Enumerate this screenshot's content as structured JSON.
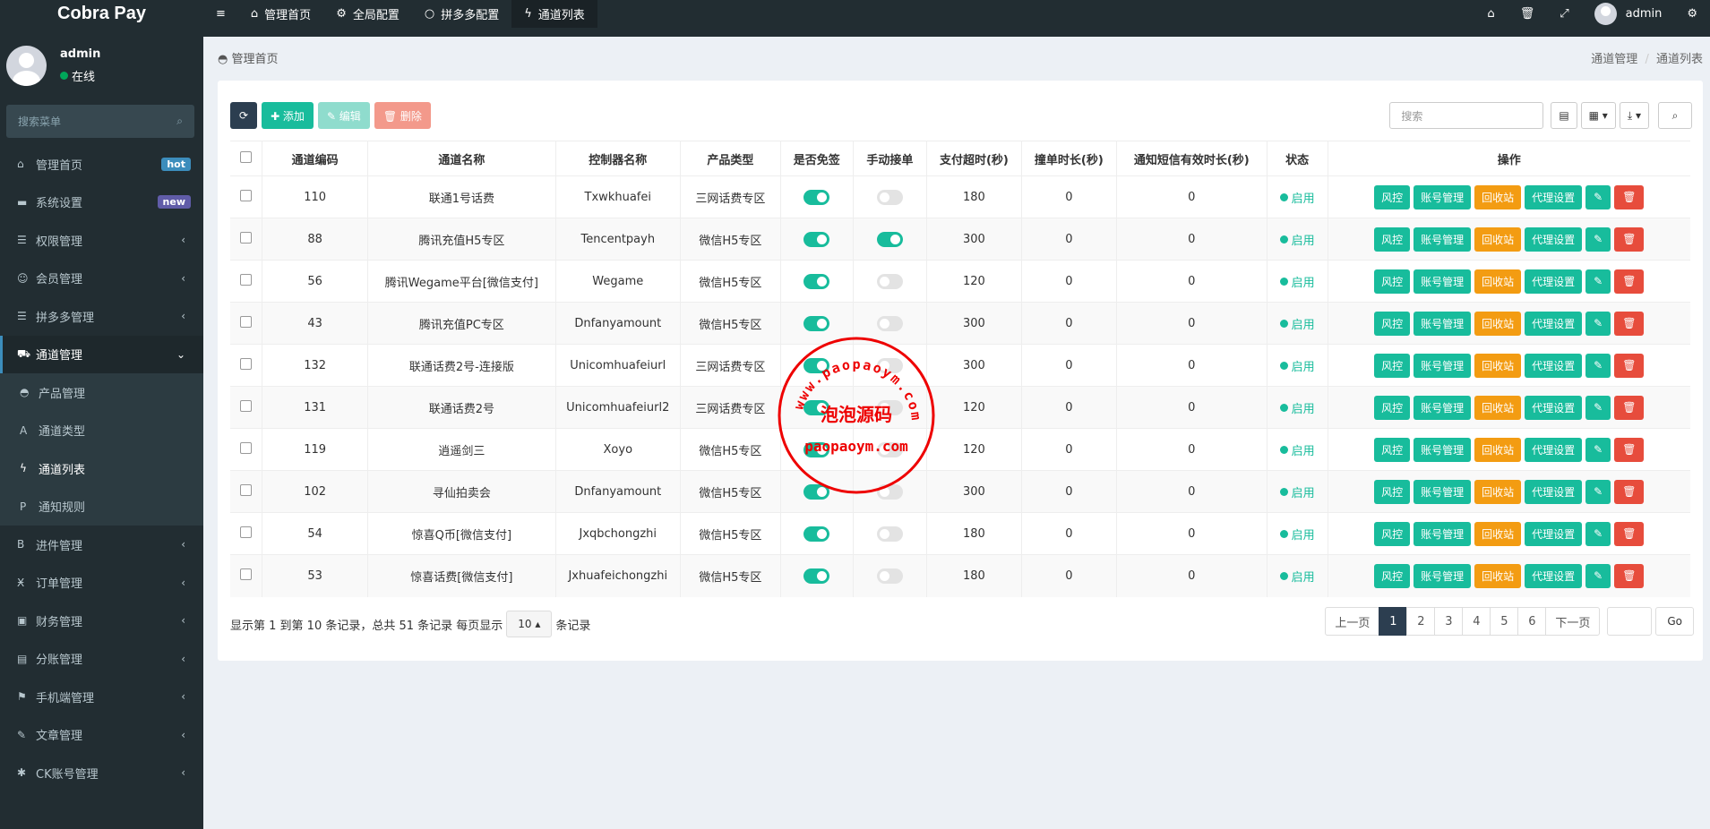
{
  "app": {
    "logo": "Cobra Pay"
  },
  "topnav": [
    {
      "icon": "≡",
      "label": ""
    },
    {
      "icon": "⌂",
      "label": "管理首页"
    },
    {
      "icon": "⚙",
      "label": "全局配置"
    },
    {
      "icon": "○",
      "label": "拼多多配置"
    },
    {
      "icon": "ϟ",
      "label": "通道列表"
    }
  ],
  "topright": {
    "username": "admin"
  },
  "sidebar": {
    "user": {
      "name": "admin",
      "status": "在线"
    },
    "search_placeholder": "搜索菜单",
    "items": [
      {
        "icon": "⌂",
        "label": "管理首页",
        "badge": "hot"
      },
      {
        "icon": "▬",
        "label": "系统设置",
        "badge": "new"
      },
      {
        "icon": "☰",
        "label": "权限管理",
        "arrow": "‹"
      },
      {
        "icon": "☺",
        "label": "会员管理",
        "arrow": "‹"
      },
      {
        "icon": "☰",
        "label": "拼多多管理",
        "arrow": "‹"
      },
      {
        "icon": "⛟",
        "label": "通道管理",
        "arrow": "⌄"
      }
    ],
    "subitems": [
      {
        "icon": "◓",
        "label": "产品管理"
      },
      {
        "icon": "A",
        "label": "通道类型"
      },
      {
        "icon": "ϟ",
        "label": "通道列表"
      },
      {
        "icon": "P",
        "label": "通知规则"
      }
    ],
    "items2": [
      {
        "icon": "B",
        "label": "进件管理",
        "arrow": "‹"
      },
      {
        "icon": "Ӿ",
        "label": "订单管理",
        "arrow": "‹"
      },
      {
        "icon": "▣",
        "label": "财务管理",
        "arrow": "‹"
      },
      {
        "icon": "▤",
        "label": "分账管理",
        "arrow": "‹"
      },
      {
        "icon": "⚑",
        "label": "手机端管理",
        "arrow": "‹"
      },
      {
        "icon": "✎",
        "label": "文章管理",
        "arrow": "‹"
      },
      {
        "icon": "✱",
        "label": "CK账号管理",
        "arrow": "‹"
      }
    ]
  },
  "breadcrumb": {
    "current": "管理首页",
    "path1": "通道管理",
    "sep": "/",
    "path2": "通道列表"
  },
  "toolbar": {
    "refresh": "⟳",
    "add": "✚ 添加",
    "edit": "✎ 编辑",
    "delete": "🗑 删除",
    "search_placeholder": "搜索"
  },
  "table": {
    "headers": [
      "",
      "通道编码",
      "通道名称",
      "控制器名称",
      "产品类型",
      "是否免签",
      "手动接单",
      "支付超时(秒)",
      "撞单时长(秒)",
      "通知短信有效时长(秒)",
      "状态",
      "操作"
    ],
    "rows": [
      {
        "code": "110",
        "name": "联通1号话费",
        "controller": "Txwkhuafei",
        "type": "三网话费专区",
        "free": "on",
        "manual": "off",
        "timeout": "180",
        "dup": "0",
        "sms": "0",
        "status": "启用"
      },
      {
        "code": "88",
        "name": "腾讯充值H5专区",
        "controller": "Tencentpayh",
        "type": "微信H5专区",
        "free": "on",
        "manual": "on",
        "timeout": "300",
        "dup": "0",
        "sms": "0",
        "status": "启用"
      },
      {
        "code": "56",
        "name": "腾讯Wegame平台[微信支付]",
        "controller": "Wegame",
        "type": "微信H5专区",
        "free": "on",
        "manual": "off",
        "timeout": "120",
        "dup": "0",
        "sms": "0",
        "status": "启用"
      },
      {
        "code": "43",
        "name": "腾讯充值PC专区",
        "controller": "Dnfanyamount",
        "type": "微信H5专区",
        "free": "on",
        "manual": "off",
        "timeout": "300",
        "dup": "0",
        "sms": "0",
        "status": "启用"
      },
      {
        "code": "132",
        "name": "联通话费2号-连接版",
        "controller": "Unicomhuafeiurl",
        "type": "三网话费专区",
        "free": "on",
        "manual": "off",
        "timeout": "300",
        "dup": "0",
        "sms": "0",
        "status": "启用"
      },
      {
        "code": "131",
        "name": "联通话费2号",
        "controller": "Unicomhuafeiurl2",
        "type": "三网话费专区",
        "free": "on",
        "manual": "off",
        "timeout": "120",
        "dup": "0",
        "sms": "0",
        "status": "启用"
      },
      {
        "code": "119",
        "name": "逍遥剑三",
        "controller": "Xoyo",
        "type": "微信H5专区",
        "free": "on",
        "manual": "off",
        "timeout": "120",
        "dup": "0",
        "sms": "0",
        "status": "启用"
      },
      {
        "code": "102",
        "name": "寻仙拍卖会",
        "controller": "Dnfanyamount",
        "type": "微信H5专区",
        "free": "on",
        "manual": "off",
        "timeout": "300",
        "dup": "0",
        "sms": "0",
        "status": "启用"
      },
      {
        "code": "54",
        "name": "惊喜Q币[微信支付]",
        "controller": "Jxqbchongzhi",
        "type": "微信H5专区",
        "free": "on",
        "manual": "off",
        "timeout": "180",
        "dup": "0",
        "sms": "0",
        "status": "启用"
      },
      {
        "code": "53",
        "name": "惊喜话费[微信支付]",
        "controller": "Jxhuafeichongzhi",
        "type": "微信H5专区",
        "free": "on",
        "manual": "off",
        "timeout": "180",
        "dup": "0",
        "sms": "0",
        "status": "启用"
      }
    ],
    "ops": [
      "风控",
      "账号管理",
      "回收站",
      "代理设置",
      "✎",
      "🗑"
    ]
  },
  "pagination": {
    "info_pre": "显示第 1 到第 10 条记录，总共 51 条记录 每页显示",
    "page_size": "10 ▴",
    "info_post": "条记录",
    "prev": "上一页",
    "pages": [
      "1",
      "2",
      "3",
      "4",
      "5",
      "6"
    ],
    "next": "下一页",
    "go": "Go"
  },
  "watermark": {
    "url_arc": "www.paopaoym.com",
    "cn": "泡泡源码",
    "bottom": "paopaoym.com"
  },
  "colors": {
    "sidebar_bg": "#222d32",
    "primary": "#18bc9c",
    "warning": "#f39c12",
    "danger": "#e74c3c",
    "dark": "#2c3e50"
  }
}
